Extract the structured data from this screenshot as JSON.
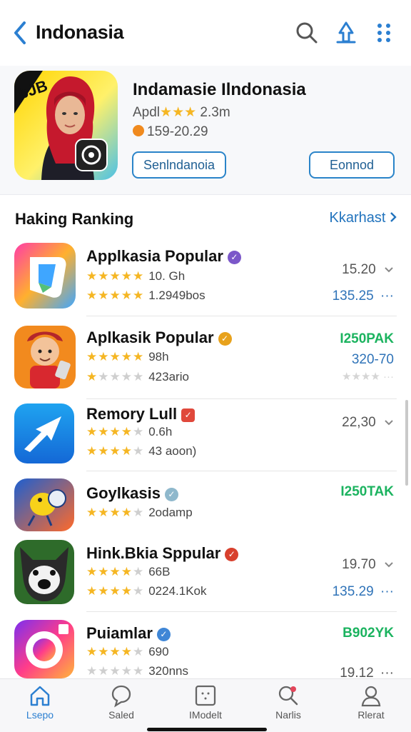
{
  "header": {
    "title": "Indonasia",
    "icons": [
      "back-chevron-icon",
      "search-icon",
      "share-icon",
      "more-dots-icon"
    ]
  },
  "hero": {
    "app_name": "Indamasie Ilndonasia",
    "rating_prefix": "Apdl",
    "rating_count": "2.3m",
    "info": "159-20.29",
    "icon_text": "bJB",
    "button_left": "Senlndanoia",
    "button_right": "Eonnod"
  },
  "section": {
    "title": "Haking Ranking",
    "see_all": "Kkarhast"
  },
  "apps": [
    {
      "name": "Applkasia Popular",
      "badge_color": "#7b57c9",
      "line1": "10. Gh",
      "line2": "1.2949bos",
      "right_top": "15.20",
      "right_top_style": "gray",
      "right_bottom": "135.25",
      "right_bottom_style": "blue"
    },
    {
      "name": "Aplkasik Popular",
      "badge_color": "#e8a21c",
      "line1": "98h",
      "line2": "423ario",
      "right_top": "I250PAK",
      "right_top_style": "green",
      "right_bottom": "320-70",
      "right_bottom_style": "blue"
    },
    {
      "name": "Remory Lull",
      "badge_color": "#e0483b",
      "line1": "0.6h",
      "line2": "43 aoon)",
      "right_top": "22,30",
      "right_top_style": "gray",
      "right_bottom": "",
      "right_bottom_style": "blue"
    },
    {
      "name": "Goylkasis",
      "badge_color": "#8fb8cc",
      "line1": "2odamp",
      "line2": "",
      "right_top": "I250TAK",
      "right_top_style": "green",
      "right_bottom": "",
      "right_bottom_style": "blue"
    },
    {
      "name": "Hink.Bkia Sppular",
      "badge_color": "#d8402d",
      "line1": "66B",
      "line2": "0224.1Kok",
      "right_top": "19.70",
      "right_top_style": "gray",
      "right_bottom": "135.29",
      "right_bottom_style": "blue"
    },
    {
      "name": "Puiamlar",
      "badge_color": "#3f86d6",
      "line1": "690",
      "line2": "320nns",
      "right_top": "B902YK",
      "right_top_style": "green",
      "right_bottom": "19.12",
      "right_bottom_style": "gray"
    }
  ],
  "tabs": [
    {
      "label": "Lsepo",
      "icon": "home-icon",
      "active": true
    },
    {
      "label": "Saled",
      "icon": "chat-icon",
      "active": false
    },
    {
      "label": "IModelt",
      "icon": "grid-icon",
      "active": false
    },
    {
      "label": "Narlis",
      "icon": "search-icon",
      "active": false
    },
    {
      "label": "Rlerat",
      "icon": "person-icon",
      "active": false
    }
  ],
  "colors": {
    "accent": "#2a84c9",
    "star": "#f5b623",
    "green": "#1bb35f",
    "blue": "#2f73b8"
  }
}
